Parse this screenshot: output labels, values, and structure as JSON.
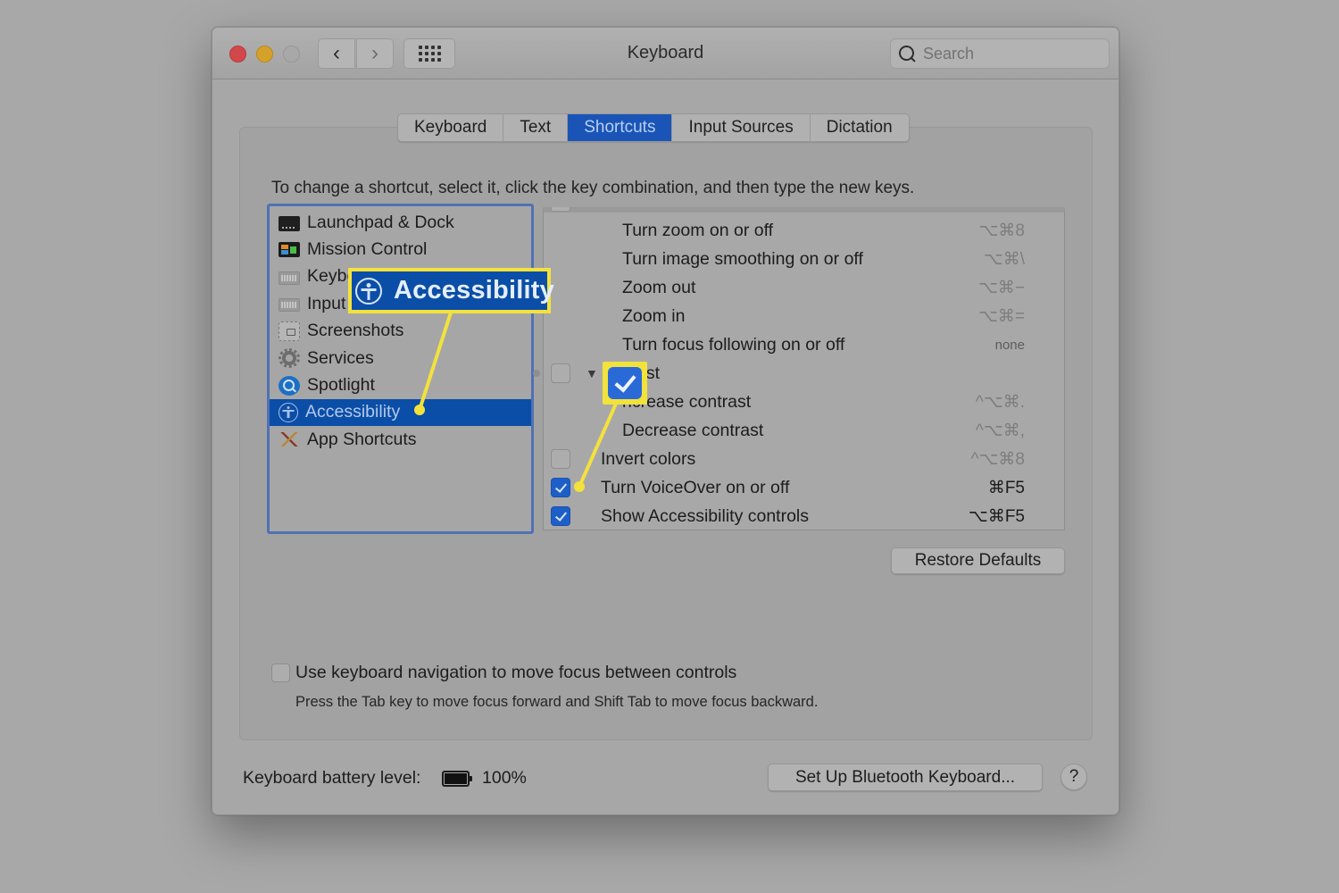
{
  "window": {
    "title": "Keyboard",
    "search_placeholder": "Search",
    "nav": {
      "back": "‹",
      "forward": "›"
    }
  },
  "tabs": [
    {
      "label": "Keyboard",
      "active": false
    },
    {
      "label": "Text",
      "active": false
    },
    {
      "label": "Shortcuts",
      "active": true
    },
    {
      "label": "Input Sources",
      "active": false
    },
    {
      "label": "Dictation",
      "active": false
    }
  ],
  "instructions": "To change a shortcut, select it, click the key combination, and then type the new keys.",
  "categories": [
    {
      "label": "Launchpad & Dock",
      "icon": "launchpad-icon",
      "selected": false
    },
    {
      "label": "Mission Control",
      "icon": "mission-control-icon",
      "selected": false
    },
    {
      "label": "Keyboard",
      "icon": "keyboard-icon",
      "selected": false
    },
    {
      "label": "Input Sources",
      "icon": "keyboard-icon",
      "selected": false
    },
    {
      "label": "Screenshots",
      "icon": "screenshot-icon",
      "selected": false
    },
    {
      "label": "Services",
      "icon": "gear-icon",
      "selected": false
    },
    {
      "label": "Spotlight",
      "icon": "spotlight-icon",
      "selected": false
    },
    {
      "label": "Accessibility",
      "icon": "accessibility-icon",
      "selected": true
    },
    {
      "label": "App Shortcuts",
      "icon": "app-shortcuts-icon",
      "selected": false
    }
  ],
  "shortcuts": [
    {
      "label": "Turn zoom on or off",
      "key": "⌥⌘8",
      "checkbox": null,
      "indent": 2,
      "key_active": false
    },
    {
      "label": "Turn image smoothing on or off",
      "key": "⌥⌘\\",
      "checkbox": null,
      "indent": 2,
      "key_active": false
    },
    {
      "label": "Zoom out",
      "key": "⌥⌘−",
      "checkbox": null,
      "indent": 2,
      "key_active": false
    },
    {
      "label": "Zoom in",
      "key": "⌥⌘=",
      "checkbox": null,
      "indent": 2,
      "key_active": false
    },
    {
      "label": "Turn focus following on or off",
      "key": "none",
      "checkbox": null,
      "indent": 2,
      "key_active": false
    },
    {
      "label": "Contrast",
      "visible_label": "ast",
      "key": "",
      "checkbox": false,
      "indent": 1,
      "disclosure": "▼",
      "key_active": false
    },
    {
      "label": "Increase contrast",
      "visible_label": "ncrease contrast",
      "key": "^⌥⌘.",
      "checkbox": null,
      "indent": 2,
      "key_active": false
    },
    {
      "label": "Decrease contrast",
      "key": "^⌥⌘,",
      "checkbox": null,
      "indent": 2,
      "key_active": false
    },
    {
      "label": "Invert colors",
      "key": "^⌥⌘8",
      "checkbox": false,
      "indent": 1,
      "key_active": false
    },
    {
      "label": "Turn VoiceOver on or off",
      "key": "⌘F5",
      "checkbox": true,
      "indent": 1,
      "key_active": true
    },
    {
      "label": "Show Accessibility controls",
      "key": "⌥⌘F5",
      "checkbox": true,
      "indent": 1,
      "key_active": true
    }
  ],
  "buttons": {
    "restore_defaults": "Restore Defaults",
    "bluetooth_setup": "Set Up Bluetooth Keyboard...",
    "help": "?"
  },
  "keyboard_navigation": {
    "checked": false,
    "label": "Use keyboard navigation to move focus between controls",
    "help": "Press the Tab key to move focus forward and Shift Tab to move focus backward."
  },
  "battery": {
    "label": "Keyboard battery level:",
    "percent_text": "100%",
    "level": 1.0
  },
  "annotations": {
    "callout_label": "Accessibility",
    "highlight_color": "#f3e23c",
    "callout_bg": "#0b4ea7"
  },
  "colors": {
    "selection": "#0b4ea7",
    "active_tab": "#1a54b6",
    "checkbox_checked": "#1d5fc7",
    "close": "#d2484a",
    "minimize": "#d4a22a"
  }
}
